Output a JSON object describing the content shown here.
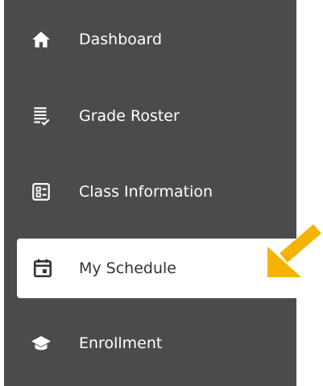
{
  "sidebar": {
    "items": [
      {
        "label": "Dashboard",
        "icon": "home-icon",
        "active": false
      },
      {
        "label": "Grade Roster",
        "icon": "grade-roster-icon",
        "active": false
      },
      {
        "label": "Class Information",
        "icon": "class-info-icon",
        "active": false
      },
      {
        "label": "My Schedule",
        "icon": "calendar-icon",
        "active": true
      },
      {
        "label": "Enrollment",
        "icon": "graduation-cap-icon",
        "active": false
      }
    ]
  },
  "colors": {
    "sidebar_bg": "#4b4b4b",
    "active_bg": "#ffffff",
    "text": "#ffffff",
    "active_text": "#333333",
    "arrow": "#f5b301"
  }
}
